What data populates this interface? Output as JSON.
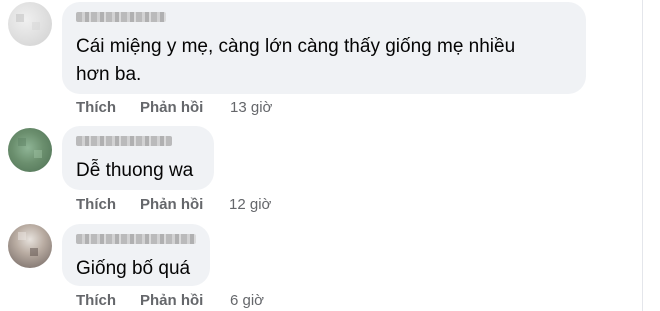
{
  "comments": [
    {
      "text_line1": "Cái miệng y mẹ, càng lớn càng thấy giống mẹ nhiều",
      "text_line2": "hơn ba.",
      "like_label": "Thích",
      "reply_label": "Phản hồi",
      "time": "13 giờ"
    },
    {
      "text_line1": "Dễ thuong wa",
      "like_label": "Thích",
      "reply_label": "Phản hồi",
      "time": "12 giờ"
    },
    {
      "text_line1": "Giống bố quá",
      "like_label": "Thích",
      "reply_label": "Phản hồi",
      "time": "6 giờ"
    }
  ],
  "colors": {
    "bubble_bg": "#f0f2f5",
    "action_text": "#65676b",
    "body_text": "#050505"
  }
}
